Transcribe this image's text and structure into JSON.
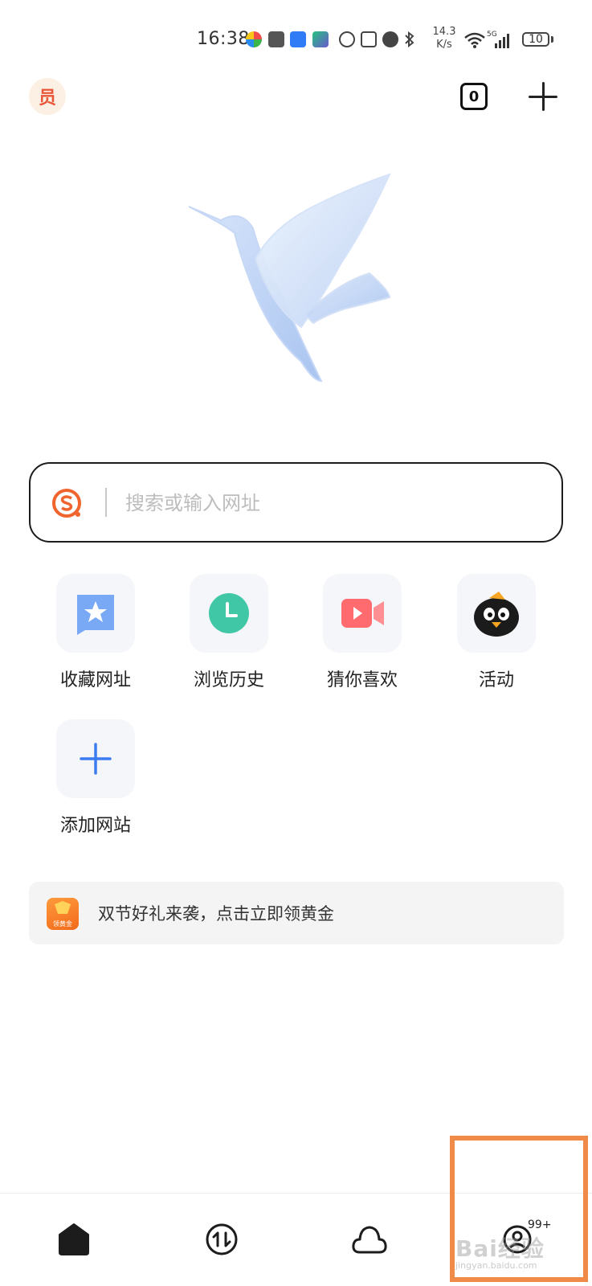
{
  "status_bar": {
    "time": "16:38",
    "speed_value": "14.3",
    "speed_unit": "K/s",
    "network": "5G",
    "battery": "10"
  },
  "top_bar": {
    "avatar_label": "员",
    "tab_count": "0"
  },
  "search": {
    "placeholder": "搜索或输入网址"
  },
  "shortcuts": [
    {
      "label": "收藏网址",
      "icon": "bookmark-star-icon"
    },
    {
      "label": "浏览历史",
      "icon": "history-clock-icon"
    },
    {
      "label": "猜你喜欢",
      "icon": "video-camera-icon"
    },
    {
      "label": "活动",
      "icon": "penguin-mascot-icon"
    },
    {
      "label": "添加网站",
      "icon": "add-icon"
    }
  ],
  "promo": {
    "icon_label": "领黄金",
    "text": "双节好礼来袭，点击立即领黄金"
  },
  "bottom_nav": {
    "items": [
      {
        "icon": "home-icon"
      },
      {
        "icon": "transfer-icon"
      },
      {
        "icon": "cloud-icon"
      },
      {
        "icon": "profile-icon"
      }
    ],
    "badge": "99+"
  },
  "watermark": {
    "main": "Bai经验",
    "sub": "jingyan.baidu.com"
  },
  "colors": {
    "accent_orange": "#ef8a48",
    "avatar_text": "#e8573a",
    "search_border": "#1c1c1c",
    "tile_bg": "#f4f6fa"
  }
}
